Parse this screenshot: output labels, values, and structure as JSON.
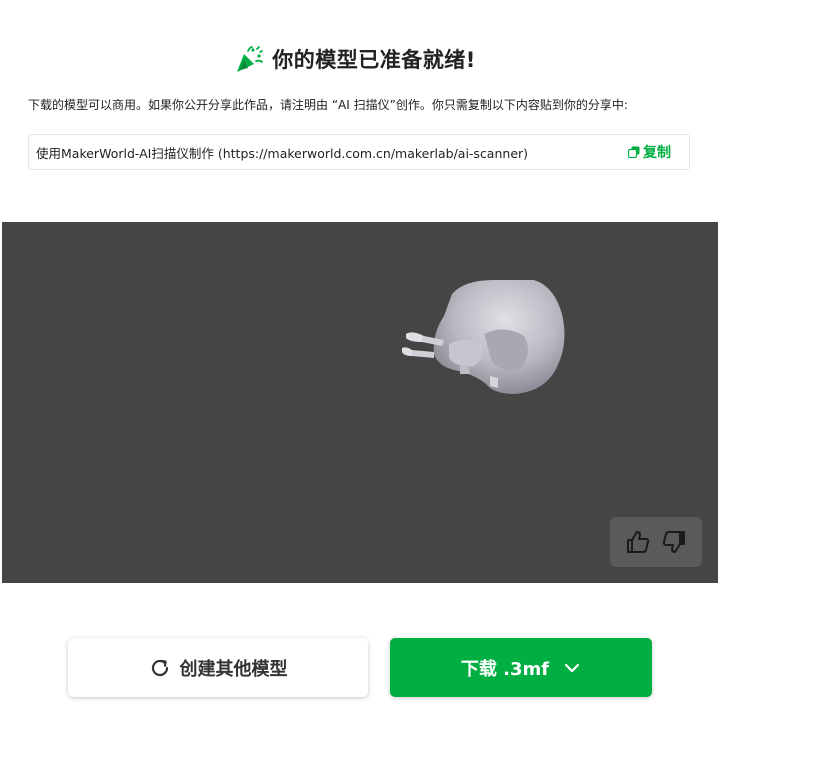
{
  "header": {
    "icon": "party-popper-icon",
    "title": "你的模型已准备就绪!"
  },
  "notice": {
    "text": "下载的模型可以商用。如果你公开分享此作品，请注明由 “AI 扫描仪”创作。你只需复制以下内容贴到你的分享中:"
  },
  "attribution": {
    "text": "使用MakerWorld-AI扫描仪制作 (https://makerworld.com.cn/makerlab/ai-scanner)",
    "copy_label": "复制",
    "copy_icon": "copy-icon"
  },
  "viewer": {
    "background": "#454545",
    "feedback": {
      "like_icon": "thumbs-up-icon",
      "dislike_icon": "thumbs-down-icon"
    }
  },
  "actions": {
    "recreate_label": "创建其他模型",
    "recreate_icon": "refresh-icon",
    "download_label": "下载 .3mf",
    "download_icon": "chevron-down-icon"
  },
  "colors": {
    "accent": "#00ae42"
  }
}
